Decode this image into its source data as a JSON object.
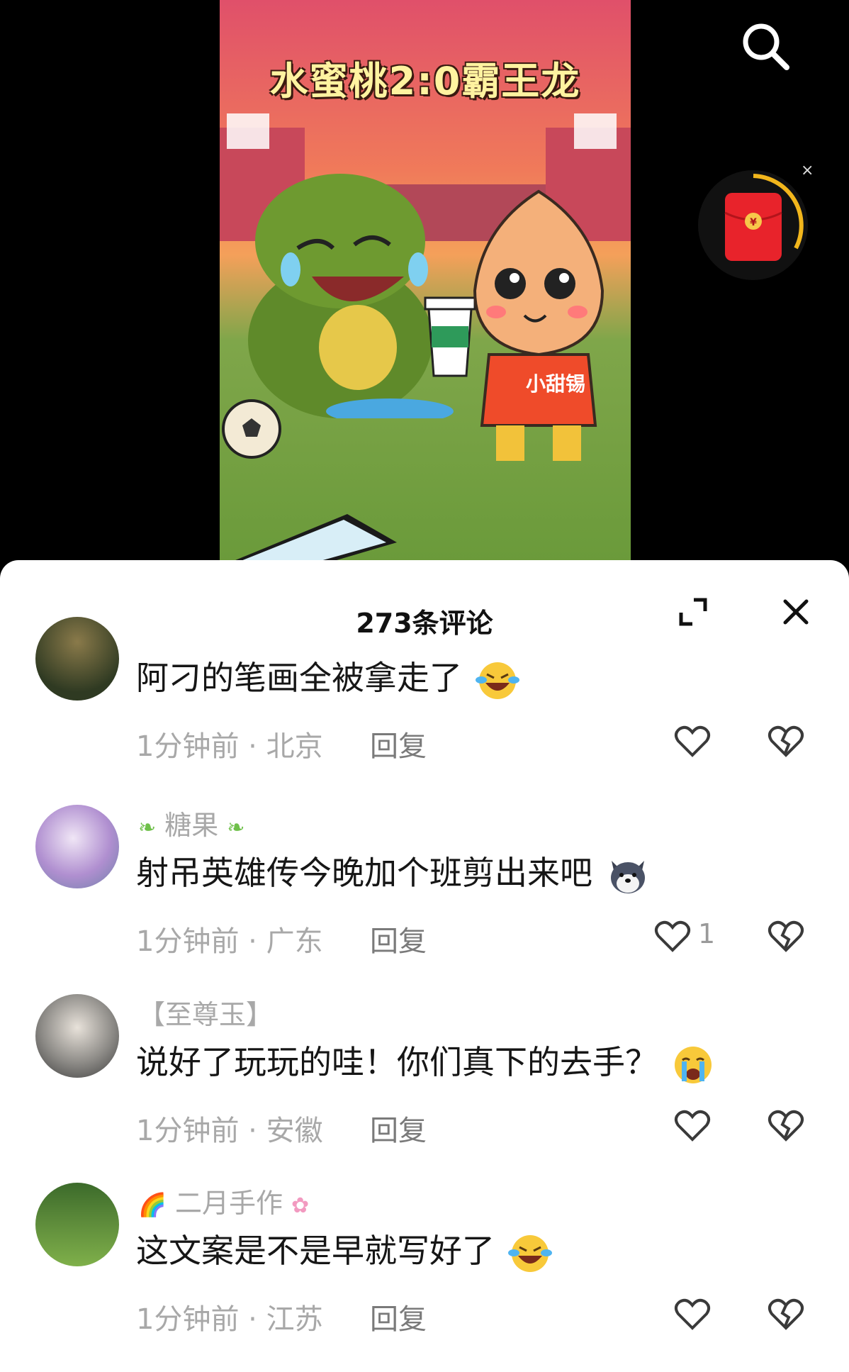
{
  "video": {
    "title": "水蜜桃2:0霸王龙",
    "jersey_text": "小甜锡"
  },
  "icons": {
    "search": "search-icon",
    "red_packet": "red-packet-icon",
    "close": "close-icon",
    "expand": "expand-icon",
    "like": "heart-icon",
    "dislike": "broken-heart-icon"
  },
  "red_packet": {
    "symbol": "¥",
    "close_label": "×"
  },
  "sheet": {
    "title": "273条评论"
  },
  "comments": [
    {
      "username": "",
      "text": "阿刁的笔画全被拿走了",
      "emoji": "laughing-crying-emoji",
      "time": "1分钟前",
      "location": "北京",
      "meta": "1分钟前 · 北京",
      "reply": "回复",
      "likes": ""
    },
    {
      "username": "糖果",
      "text": "射吊英雄传今晚加个班剪出来吧",
      "emoji": "husky-emoji",
      "time": "1分钟前",
      "location": "广东",
      "meta": "1分钟前 · 广东",
      "reply": "回复",
      "likes": "1"
    },
    {
      "username": "【至尊玉】",
      "text": "说好了玩玩的哇！你们真下的去手？",
      "emoji": "crying-emoji",
      "time": "1分钟前",
      "location": "安徽",
      "meta": "1分钟前 · 安徽",
      "reply": "回复",
      "likes": ""
    },
    {
      "username": "二月手作",
      "text": "这文案是不是早就写好了",
      "emoji": "laughing-crying-emoji",
      "time": "1分钟前",
      "location": "江苏",
      "meta": "1分钟前 · 江苏",
      "reply": "回复",
      "likes": ""
    }
  ],
  "colors": {
    "accent_red": "#e8232b",
    "meta_gray": "#a8a8a8"
  }
}
